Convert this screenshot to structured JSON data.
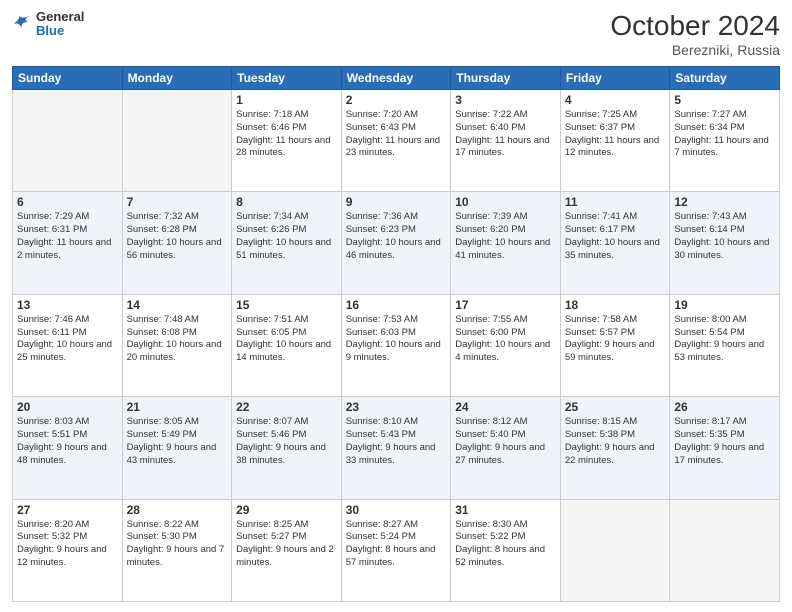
{
  "header": {
    "logo": {
      "general": "General",
      "blue": "Blue"
    },
    "title": "October 2024",
    "location": "Berezniki, Russia"
  },
  "weekdays": [
    "Sunday",
    "Monday",
    "Tuesday",
    "Wednesday",
    "Thursday",
    "Friday",
    "Saturday"
  ],
  "weeks": [
    [
      {
        "day": "",
        "detail": ""
      },
      {
        "day": "",
        "detail": ""
      },
      {
        "day": "1",
        "detail": "Sunrise: 7:18 AM\nSunset: 6:46 PM\nDaylight: 11 hours and 28 minutes."
      },
      {
        "day": "2",
        "detail": "Sunrise: 7:20 AM\nSunset: 6:43 PM\nDaylight: 11 hours and 23 minutes."
      },
      {
        "day": "3",
        "detail": "Sunrise: 7:22 AM\nSunset: 6:40 PM\nDaylight: 11 hours and 17 minutes."
      },
      {
        "day": "4",
        "detail": "Sunrise: 7:25 AM\nSunset: 6:37 PM\nDaylight: 11 hours and 12 minutes."
      },
      {
        "day": "5",
        "detail": "Sunrise: 7:27 AM\nSunset: 6:34 PM\nDaylight: 11 hours and 7 minutes."
      }
    ],
    [
      {
        "day": "6",
        "detail": "Sunrise: 7:29 AM\nSunset: 6:31 PM\nDaylight: 11 hours and 2 minutes."
      },
      {
        "day": "7",
        "detail": "Sunrise: 7:32 AM\nSunset: 6:28 PM\nDaylight: 10 hours and 56 minutes."
      },
      {
        "day": "8",
        "detail": "Sunrise: 7:34 AM\nSunset: 6:26 PM\nDaylight: 10 hours and 51 minutes."
      },
      {
        "day": "9",
        "detail": "Sunrise: 7:36 AM\nSunset: 6:23 PM\nDaylight: 10 hours and 46 minutes."
      },
      {
        "day": "10",
        "detail": "Sunrise: 7:39 AM\nSunset: 6:20 PM\nDaylight: 10 hours and 41 minutes."
      },
      {
        "day": "11",
        "detail": "Sunrise: 7:41 AM\nSunset: 6:17 PM\nDaylight: 10 hours and 35 minutes."
      },
      {
        "day": "12",
        "detail": "Sunrise: 7:43 AM\nSunset: 6:14 PM\nDaylight: 10 hours and 30 minutes."
      }
    ],
    [
      {
        "day": "13",
        "detail": "Sunrise: 7:46 AM\nSunset: 6:11 PM\nDaylight: 10 hours and 25 minutes."
      },
      {
        "day": "14",
        "detail": "Sunrise: 7:48 AM\nSunset: 6:08 PM\nDaylight: 10 hours and 20 minutes."
      },
      {
        "day": "15",
        "detail": "Sunrise: 7:51 AM\nSunset: 6:05 PM\nDaylight: 10 hours and 14 minutes."
      },
      {
        "day": "16",
        "detail": "Sunrise: 7:53 AM\nSunset: 6:03 PM\nDaylight: 10 hours and 9 minutes."
      },
      {
        "day": "17",
        "detail": "Sunrise: 7:55 AM\nSunset: 6:00 PM\nDaylight: 10 hours and 4 minutes."
      },
      {
        "day": "18",
        "detail": "Sunrise: 7:58 AM\nSunset: 5:57 PM\nDaylight: 9 hours and 59 minutes."
      },
      {
        "day": "19",
        "detail": "Sunrise: 8:00 AM\nSunset: 5:54 PM\nDaylight: 9 hours and 53 minutes."
      }
    ],
    [
      {
        "day": "20",
        "detail": "Sunrise: 8:03 AM\nSunset: 5:51 PM\nDaylight: 9 hours and 48 minutes."
      },
      {
        "day": "21",
        "detail": "Sunrise: 8:05 AM\nSunset: 5:49 PM\nDaylight: 9 hours and 43 minutes."
      },
      {
        "day": "22",
        "detail": "Sunrise: 8:07 AM\nSunset: 5:46 PM\nDaylight: 9 hours and 38 minutes."
      },
      {
        "day": "23",
        "detail": "Sunrise: 8:10 AM\nSunset: 5:43 PM\nDaylight: 9 hours and 33 minutes."
      },
      {
        "day": "24",
        "detail": "Sunrise: 8:12 AM\nSunset: 5:40 PM\nDaylight: 9 hours and 27 minutes."
      },
      {
        "day": "25",
        "detail": "Sunrise: 8:15 AM\nSunset: 5:38 PM\nDaylight: 9 hours and 22 minutes."
      },
      {
        "day": "26",
        "detail": "Sunrise: 8:17 AM\nSunset: 5:35 PM\nDaylight: 9 hours and 17 minutes."
      }
    ],
    [
      {
        "day": "27",
        "detail": "Sunrise: 8:20 AM\nSunset: 5:32 PM\nDaylight: 9 hours and 12 minutes."
      },
      {
        "day": "28",
        "detail": "Sunrise: 8:22 AM\nSunset: 5:30 PM\nDaylight: 9 hours and 7 minutes."
      },
      {
        "day": "29",
        "detail": "Sunrise: 8:25 AM\nSunset: 5:27 PM\nDaylight: 9 hours and 2 minutes."
      },
      {
        "day": "30",
        "detail": "Sunrise: 8:27 AM\nSunset: 5:24 PM\nDaylight: 8 hours and 57 minutes."
      },
      {
        "day": "31",
        "detail": "Sunrise: 8:30 AM\nSunset: 5:22 PM\nDaylight: 8 hours and 52 minutes."
      },
      {
        "day": "",
        "detail": ""
      },
      {
        "day": "",
        "detail": ""
      }
    ]
  ]
}
